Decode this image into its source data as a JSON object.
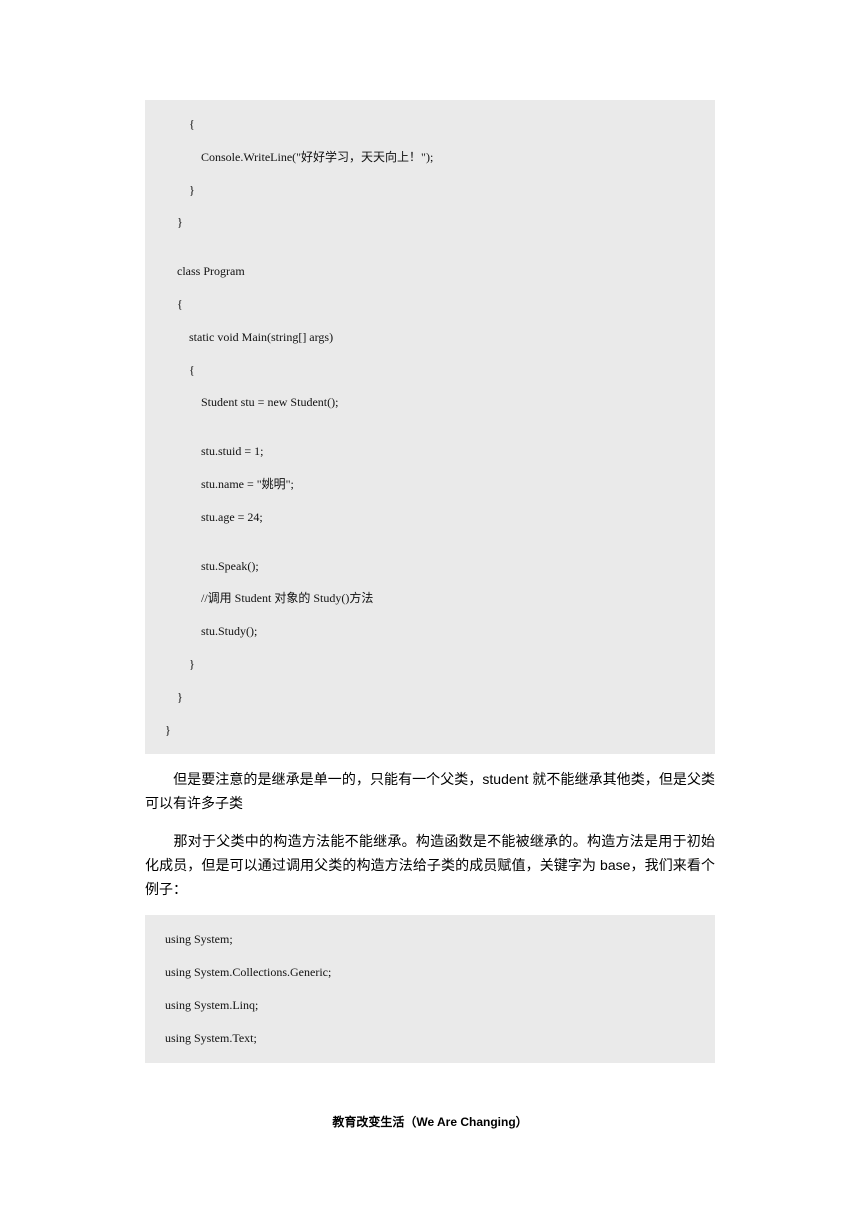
{
  "codeBlock1": {
    "lines": [
      "        {",
      "            Console.WriteLine(\"好好学习，天天向上！\");",
      "        }",
      "    }",
      "",
      "    class Program",
      "    {",
      "        static void Main(string[] args)",
      "        {",
      "            Student stu = new Student();",
      "",
      "            stu.stuid = 1;",
      "            stu.name = \"姚明\";",
      "            stu.age = 24;",
      "",
      "            stu.Speak();",
      "            //调用 Student 对象的 Study()方法",
      "            stu.Study();",
      "        }",
      "    }",
      "}"
    ]
  },
  "para1": "　　但是要注意的是继承是单一的，只能有一个父类，student 就不能继承其他类，但是父类可以有许多子类",
  "para2": "　　那对于父类中的构造方法能不能继承。构造函数是不能被继承的。构造方法是用于初始化成员，但是可以通过调用父类的构造方法给子类的成员赋值，关键字为 base，我们来看个例子：",
  "codeBlock2": {
    "lines": [
      "using System;",
      "using System.Collections.Generic;",
      "using System.Linq;",
      "using System.Text;"
    ]
  },
  "footer": "教育改变生活（We Are Changing）"
}
